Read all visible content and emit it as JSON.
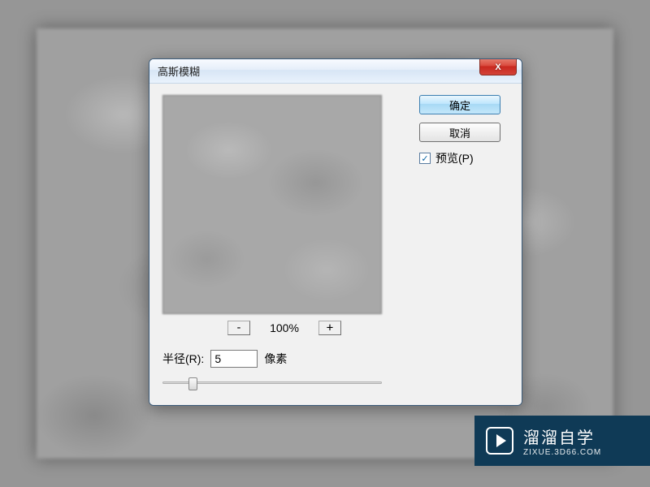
{
  "dialog": {
    "title": "高斯模糊",
    "close_symbol": "X",
    "zoom": {
      "minus": "-",
      "plus": "+",
      "value": "100%"
    },
    "radius": {
      "label": "半径(R):",
      "value": "5",
      "unit": "像素"
    },
    "buttons": {
      "ok": "确定",
      "cancel": "取消"
    },
    "preview": {
      "label": "预览(P)",
      "checked": "✓"
    }
  },
  "watermark": {
    "title": "溜溜自学",
    "sub": "ZIXUE.3D66.COM"
  }
}
